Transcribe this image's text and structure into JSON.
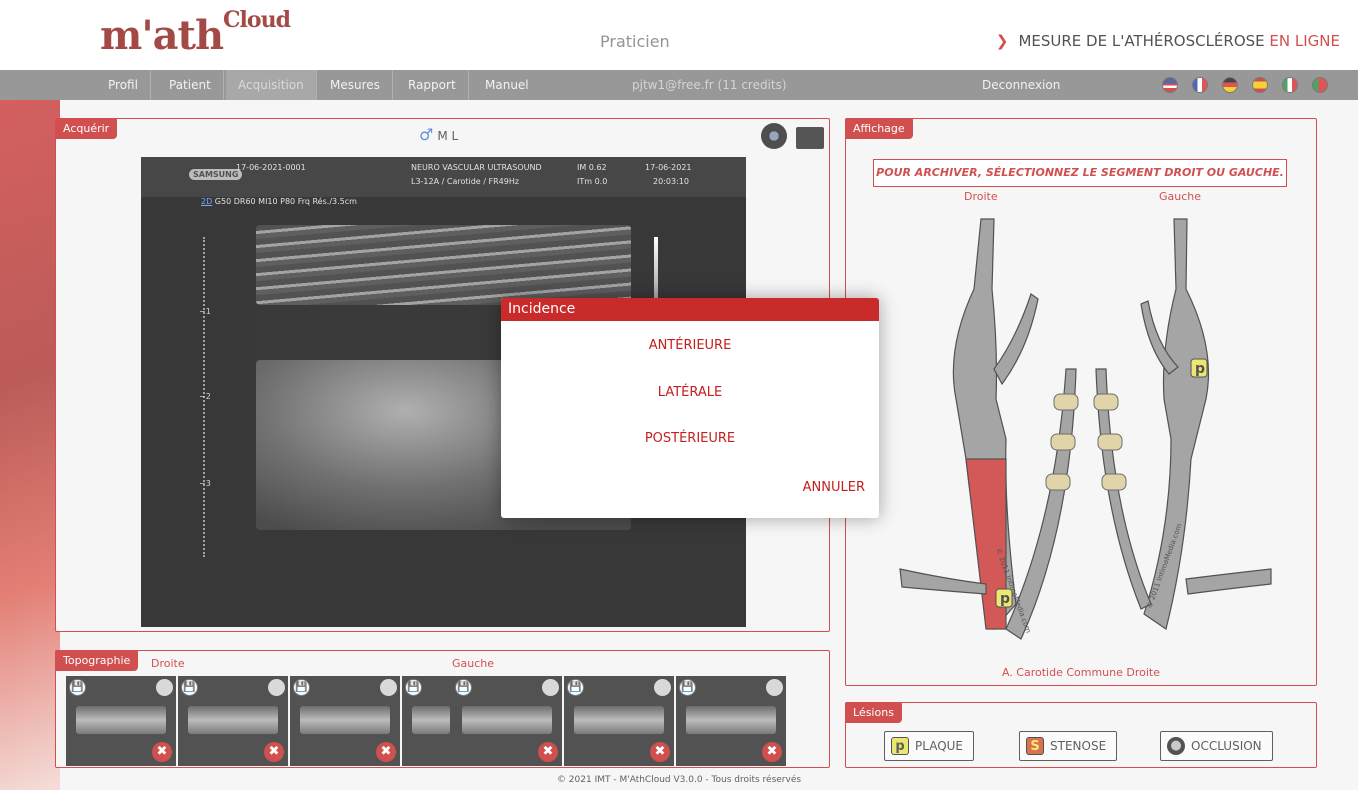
{
  "header": {
    "logo_main": "m'ath",
    "logo_sup": "Cloud",
    "role": "Praticien",
    "tagline_chevron": "❯",
    "tagline": "MESURE DE L'ATHÉROSCLÉROSE",
    "tagline_accent": "EN LIGNE"
  },
  "nav": {
    "items": [
      "Profil",
      "Patient",
      "Acquisition",
      "Mesures",
      "Rapport",
      "Manuel"
    ],
    "email": "pjtw1@free.fr (11 credits)",
    "logout": "Deconnexion"
  },
  "flags": [
    "us-flag",
    "france-flag",
    "germany-flag",
    "spain-flag",
    "italy-flag",
    "portugal-flag"
  ],
  "acquire": {
    "title": "Acquérir",
    "patient_symbol": "♂",
    "patient_initials": "M L"
  },
  "ultrasound": {
    "brand": "SAMSUNG",
    "exam_id": "17-06-2021-0001",
    "study": "NEURO VASCULAR ULTRASOUND",
    "probe": "L3-12A / Carotide / FR49Hz",
    "im": "IM 0.62",
    "itm": "ITm 0.0",
    "date": "17-06-2021",
    "time": "20:03:10",
    "params_mode": "2D",
    "params": "G50 DR60 MI10 P80 Frq Rés./3.5cm",
    "depth_1": "−1",
    "depth_2": "−2",
    "depth_3": "−3"
  },
  "display": {
    "title": "Affichage",
    "notice": "POUR ARCHIVER, SÉLECTIONNEZ LE SEGMENT DROIT OU GAUCHE.",
    "right_label": "Droite",
    "left_label": "Gauche",
    "copyright_r": "© 2011 IntimaMedia.com",
    "copyright_l": "© 2011 IntimaMedia.com",
    "plaque_mark": "p",
    "caption": "A. Carotide Commune Droite"
  },
  "topography": {
    "title": "Topographie",
    "right": "Droite",
    "left": "Gauche",
    "save_glyph": "💾",
    "delete_glyph": "✖"
  },
  "lesions": {
    "title": "Lésions",
    "items": [
      {
        "glyph": "p",
        "label": "PLAQUE"
      },
      {
        "glyph": "S",
        "label": "STENOSE"
      },
      {
        "glyph": "●",
        "label": "OCCLUSION"
      }
    ]
  },
  "modal": {
    "title": "Incidence",
    "options": [
      "ANTÉRIEURE",
      "LATÉRALE",
      "POSTÉRIEURE"
    ],
    "cancel": "ANNULER"
  },
  "footer": "© 2021 IMT - M'AthCloud V3.0.0 - Tous droits réservés",
  "colors": {
    "accent": "#c41e1e",
    "nav_bg": "#7b7b7b",
    "artery": "#8c8c8c",
    "highlight": "#c72a2a",
    "plaque": "#e8e04a"
  }
}
